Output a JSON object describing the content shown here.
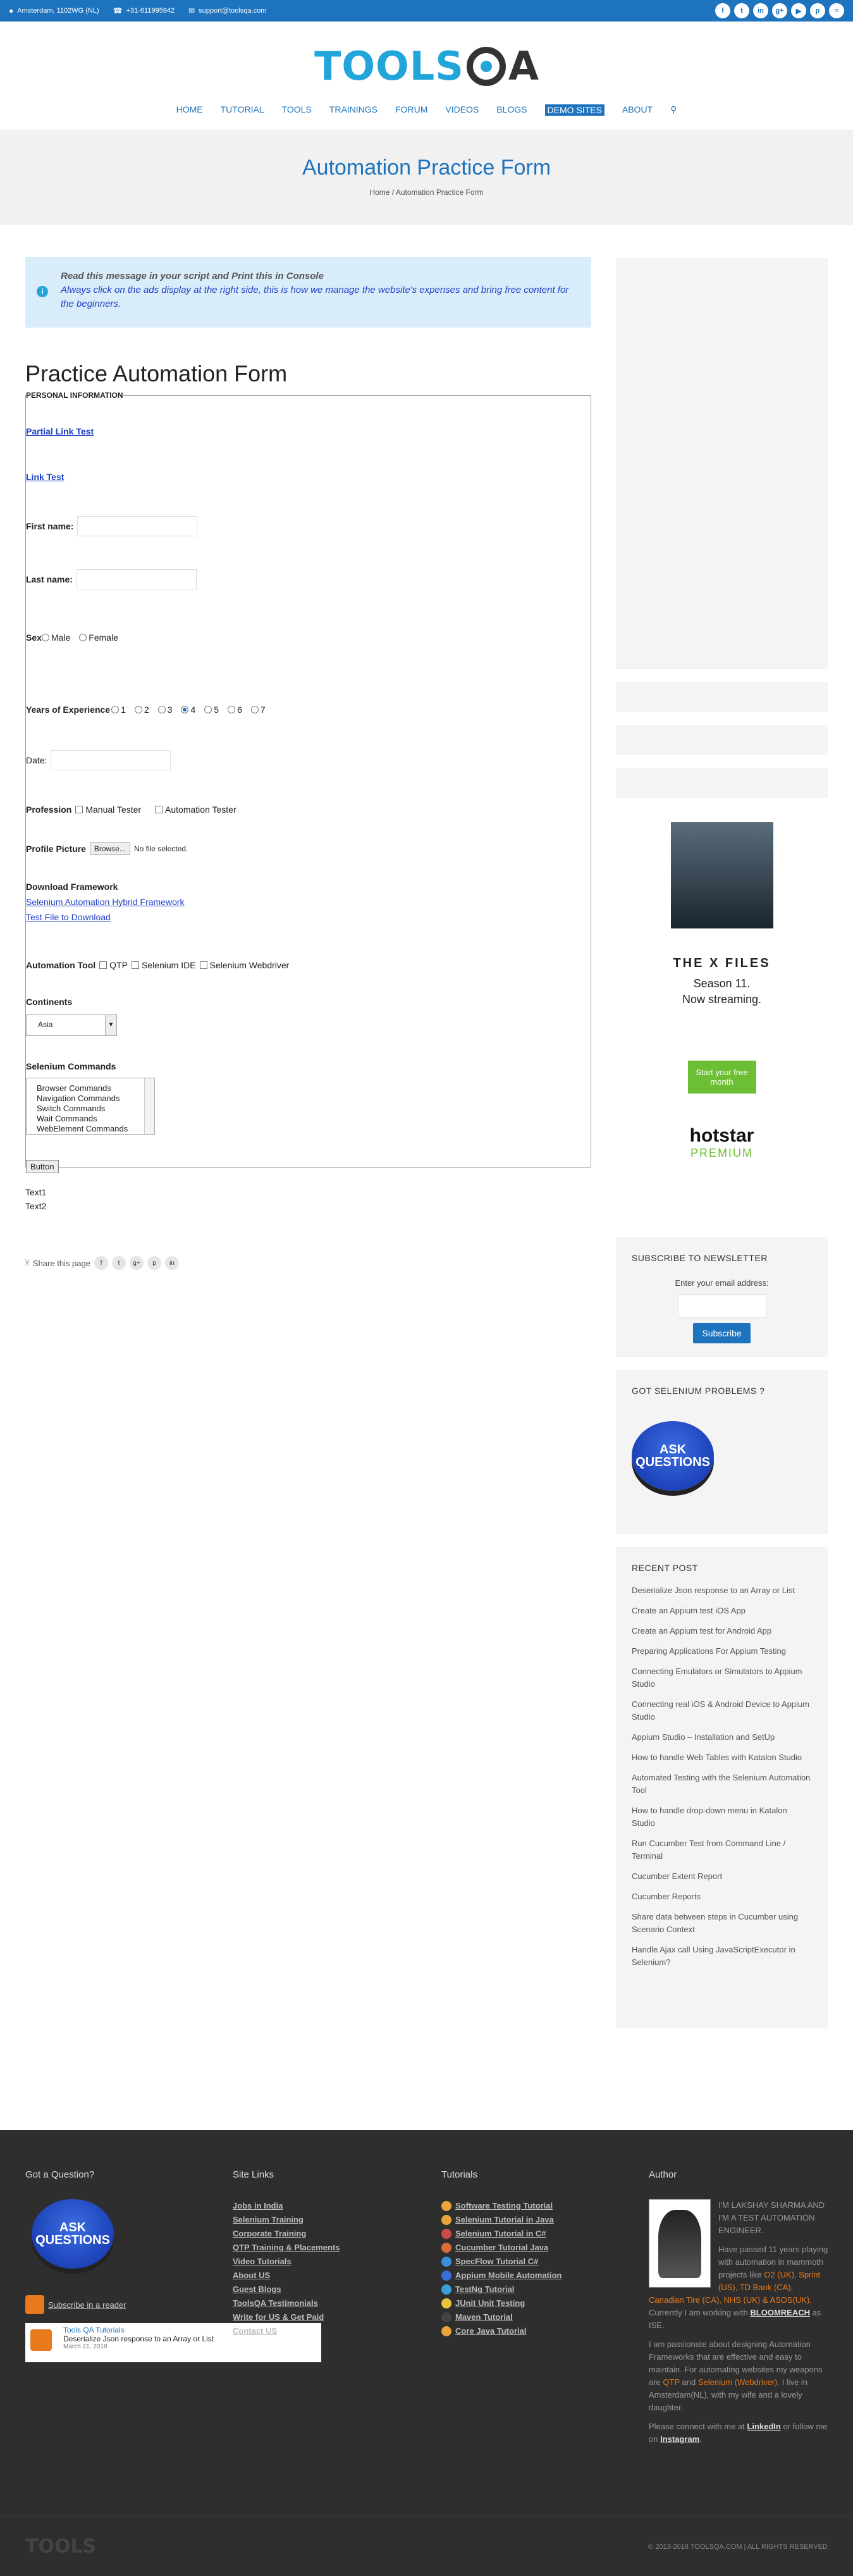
{
  "topbar": {
    "address": "Amsterdam, 1102WG (NL)",
    "phone": "+31-611995942",
    "email": "support@toolsqa.com",
    "social_icons": [
      "facebook-icon",
      "twitter-icon",
      "linkedin-icon",
      "google-plus-icon",
      "youtube-icon",
      "pinterest-icon",
      "rss-icon"
    ]
  },
  "logo": {
    "part1": "TOOLS",
    "part2": "A"
  },
  "nav": {
    "items": [
      "HOME",
      "TUTORIAL",
      "TOOLS",
      "TRAININGS",
      "FORUM",
      "VIDEOS",
      "BLOGS",
      "DEMO SITES",
      "ABOUT"
    ],
    "active": "DEMO SITES"
  },
  "page": {
    "title": "Automation Practice Form",
    "breadcrumb": [
      "Home",
      "Automation Practice Form"
    ]
  },
  "notice": {
    "line1": "Read this message in your script and Print this in Console",
    "line2": "Always click on the ads display at the right side, this is how we manage the website's expenses and bring free content for the beginners."
  },
  "form": {
    "title": "Practice Automation Form",
    "legend": "PERSONAL INFORMATION",
    "partial_link": "Partial Link Test",
    "link": "Link Test",
    "first_name_label": "First name:",
    "last_name_label": "Last name:",
    "sex_label": "Sex",
    "sex_options": [
      "Male",
      "Female"
    ],
    "experience_label": "Years of Experience",
    "experience_options": [
      "1",
      "2",
      "3",
      "4",
      "5",
      "6",
      "7"
    ],
    "experience_selected": "4",
    "date_label": "Date:",
    "profession_label": "Profession",
    "profession_options": [
      "Manual Tester",
      "Automation Tester"
    ],
    "profile_label": "Profile Picture",
    "browse_label": "Browse...",
    "no_file": "No file selected.",
    "download_label": "Download Framework",
    "download_link1": "Selenium Automation Hybrid Framework",
    "download_link2": "Test File to Download",
    "tool_label": "Automation Tool",
    "tool_options": [
      "QTP",
      "Selenium IDE",
      "Selenium Webdriver"
    ],
    "continents_label": "Continents",
    "continent_selected": "Asia",
    "commands_label": "Selenium Commands",
    "commands": [
      "Browser Commands",
      "Navigation Commands",
      "Switch Commands",
      "Wait Commands",
      "WebElement Commands"
    ],
    "button_label": "Button"
  },
  "texts": [
    "Text1",
    "Text2"
  ],
  "share": {
    "label": "Share this page",
    "icons": [
      "facebook-icon",
      "twitter-icon",
      "google-plus-icon",
      "pinterest-icon",
      "linkedin-icon"
    ]
  },
  "ad": {
    "brand": "THE X FILES",
    "line1": "Season 11.",
    "line2": "Now streaming.",
    "cta": "Start your free month",
    "service": "hotstar",
    "tier": "PREMIUM"
  },
  "newsletter": {
    "title": "SUBSCRIBE TO NEWSLETTER",
    "label": "Enter your email address:",
    "button": "Subscribe"
  },
  "selenium_problems": {
    "title": "GOT SELENIUM PROBLEMS ?",
    "badge": "ASK QUESTIONS"
  },
  "recent": {
    "title": "RECENT POST",
    "posts": [
      "Deserialize Json response to an Array or List",
      "Create an Appium test iOS App",
      "Create an Appium test for Android App",
      "Preparing Applications For Appium Testing",
      "Connecting Emulators or Simulators to Appium Studio",
      "Connecting real iOS & Android  Device to Appium Studio",
      "Appium Studio – Installation and SetUp",
      "How to handle Web Tables with Katalon Studio",
      "Automated Testing with the Selenium Automation Tool",
      "How to handle drop-down menu in Katalon Studio",
      "Run Cucumber Test from Command Line / Terminal",
      "Cucumber Extent Report",
      "Cucumber Reports",
      "Share data between steps in Cucumber using Scenario Context",
      "Handle Ajax call Using JavaScriptExecutor in Selenium?"
    ]
  },
  "footer": {
    "question_title": "Got a Question?",
    "badge": "ASK QUESTIONS",
    "subscribe": "Subscribe in a reader",
    "feed_title": "Tools QA Tutorials",
    "feed_item": "Deserialize Json response to an Array or List",
    "feed_date": "March 21, 2018",
    "site_links_title": "Site Links",
    "site_links": [
      "Jobs in India",
      "Selenium Training",
      "Corporate Training",
      "QTP Training & Placements",
      "Video Tutorials",
      "About US",
      "Guest Blogs",
      "ToolsQA Testimonials",
      "Write for US & Get Paid",
      "Contact US"
    ],
    "tutorials_title": "Tutorials",
    "tutorials": [
      "Software Testing Tutorial",
      "Selenium Tutorial in Java",
      "Selenium Tutorial in C#",
      "Cucumber Tutorial Java",
      "SpecFlow Tutorial C#",
      "Appium Mobile Automation",
      "TestNg Tutorial",
      "JUnit Unit Testing",
      "Maven Tutorial",
      "Core Java Tutorial"
    ],
    "author_title": "Author",
    "author_intro": "I'M LAKSHAY SHARMA AND I'M A TEST AUTOMATION ENGINEER.",
    "author_p1": "Have passed 11 years playing with automation in mammoth projects like",
    "author_companies": "O2 (UK), Sprint (US), TD Bank (CA), Canadian Tire (CA), NHS (UK) & ASOS(UK).",
    "author_p2": "Currently I am working with",
    "author_company": "BLOOMREACH",
    "author_p3": "as ISE.",
    "author_p4": "I am passionate about designing Automation Frameworks that are effective and easy to maintain. For automating websites my weapons are",
    "author_w1": "QTP",
    "author_and": "and",
    "author_w2": "Selenium (Webdriver)",
    "author_p5": ". I live in Amsterdam(NL), with my wife and a lovely daughter.",
    "author_p6": "Please connect with me at",
    "author_s1": "LinkedIn",
    "author_or": "or follow me on",
    "author_s2": "Instagram",
    "logo": "TOOLS",
    "copyright": "© 2013-2018 TOOLSQA.COM | ALL RIGHTS RESERVED"
  }
}
